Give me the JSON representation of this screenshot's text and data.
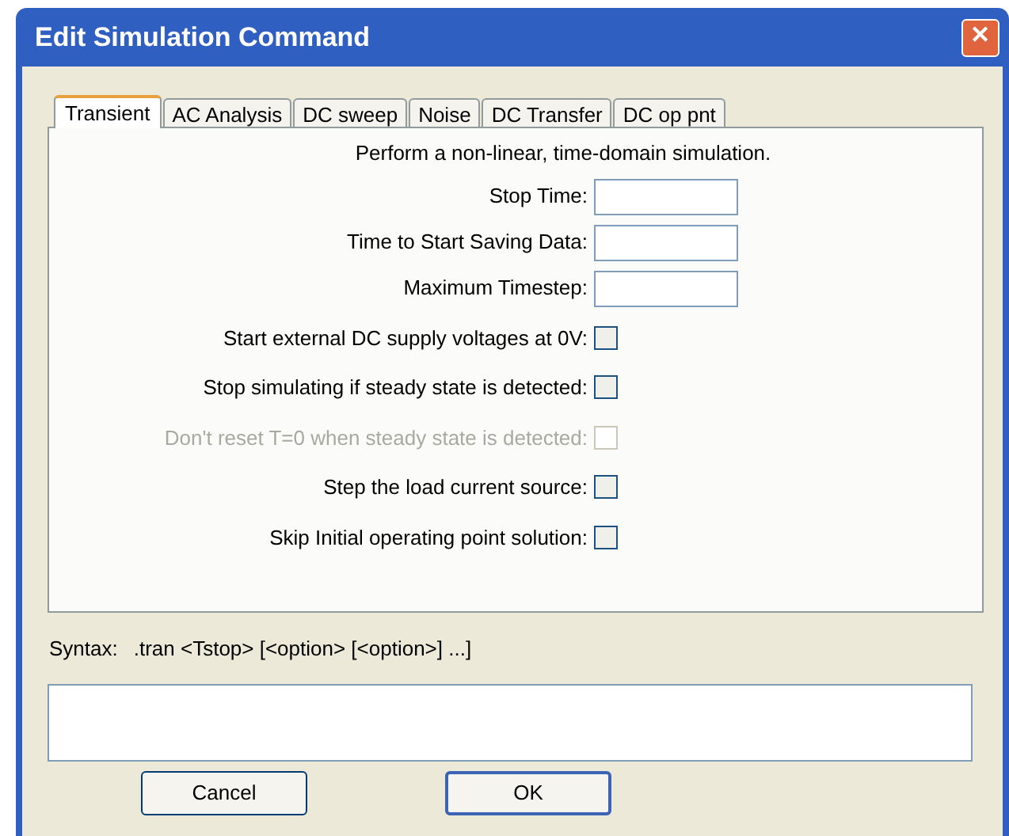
{
  "window": {
    "title": "Edit Simulation Command",
    "close": "✕"
  },
  "tabs": [
    {
      "label": "Transient",
      "selected": true
    },
    {
      "label": "AC Analysis",
      "selected": false
    },
    {
      "label": "DC sweep",
      "selected": false
    },
    {
      "label": "Noise",
      "selected": false
    },
    {
      "label": "DC Transfer",
      "selected": false
    },
    {
      "label": "DC op pnt",
      "selected": false
    }
  ],
  "description": "Perform a non-linear, time-domain simulation.",
  "fields": [
    {
      "label": "Stop Time:"
    },
    {
      "label": "Time to Start Saving Data:"
    },
    {
      "label": "Maximum Timestep:"
    }
  ],
  "options": [
    {
      "label": "Start external DC supply voltages at 0V:",
      "checked": false,
      "disabled": false
    },
    {
      "label": "Stop simulating if steady state is detected:",
      "checked": false,
      "disabled": false
    },
    {
      "label": "Don't reset T=0 when steady state is detected:",
      "checked": false,
      "disabled": true
    },
    {
      "label": "Step the load current source:",
      "checked": false,
      "disabled": false
    },
    {
      "label": "Skip Initial operating point solution:",
      "checked": false,
      "disabled": false
    }
  ],
  "syntax": {
    "label": "Syntax:",
    "text": ".tran <Tstop> [<option> [<option>] ...]"
  },
  "buttons": [
    {
      "label": "Cancel",
      "default": false
    },
    {
      "label": "OK",
      "default": true
    }
  ]
}
